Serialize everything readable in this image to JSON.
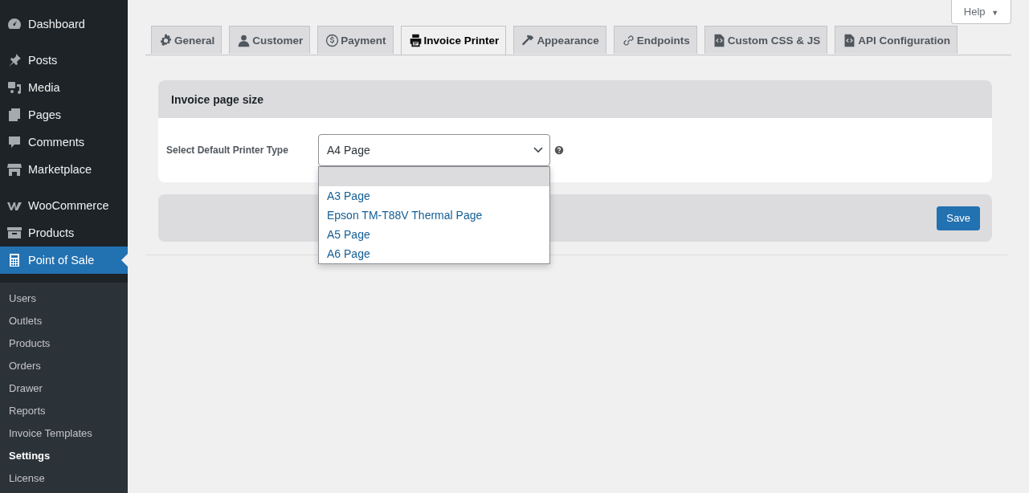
{
  "sidebar": {
    "menu_groups": [
      [
        {
          "label": "Dashboard",
          "selected": false
        }
      ],
      [
        {
          "label": "Posts",
          "selected": false
        },
        {
          "label": "Media",
          "selected": false
        },
        {
          "label": "Pages",
          "selected": false
        },
        {
          "label": "Comments",
          "selected": false
        },
        {
          "label": "Marketplace",
          "selected": false
        }
      ],
      [
        {
          "label": "WooCommerce",
          "selected": false
        },
        {
          "label": "Products",
          "selected": false
        },
        {
          "label": "Point of Sale",
          "selected": true
        }
      ]
    ],
    "submenu": [
      {
        "label": "Users",
        "selected": false
      },
      {
        "label": "Outlets",
        "selected": false
      },
      {
        "label": "Products",
        "selected": false
      },
      {
        "label": "Orders",
        "selected": false
      },
      {
        "label": "Drawer",
        "selected": false
      },
      {
        "label": "Reports",
        "selected": false
      },
      {
        "label": "Invoice Templates",
        "selected": false
      },
      {
        "label": "Settings",
        "selected": true
      },
      {
        "label": "License",
        "selected": false
      }
    ]
  },
  "help_button": {
    "label": "Help",
    "caret": "▼"
  },
  "tabs": [
    {
      "label": "General",
      "selected": false
    },
    {
      "label": "Customer",
      "selected": false
    },
    {
      "label": "Payment",
      "selected": false
    },
    {
      "label": "Invoice Printer",
      "selected": true
    },
    {
      "label": "Appearance",
      "selected": false
    },
    {
      "label": "Endpoints",
      "selected": false
    },
    {
      "label": "Custom CSS & JS",
      "selected": false
    },
    {
      "label": "API Configuration",
      "selected": false
    }
  ],
  "panel": {
    "title": "Invoice page size",
    "field": {
      "label": "Select Default Printer Type",
      "value": "A4 Page",
      "expanded": true,
      "options": [
        {
          "highlighted": true
        },
        {
          "label": "A3 Page",
          "highlighted": false
        },
        {
          "label": "Epson TM-T88V Thermal Page",
          "highlighted": false
        },
        {
          "label": "A5 Page",
          "highlighted": false
        },
        {
          "label": "A6 Page",
          "highlighted": false
        }
      ]
    }
  },
  "save_button": "Save"
}
